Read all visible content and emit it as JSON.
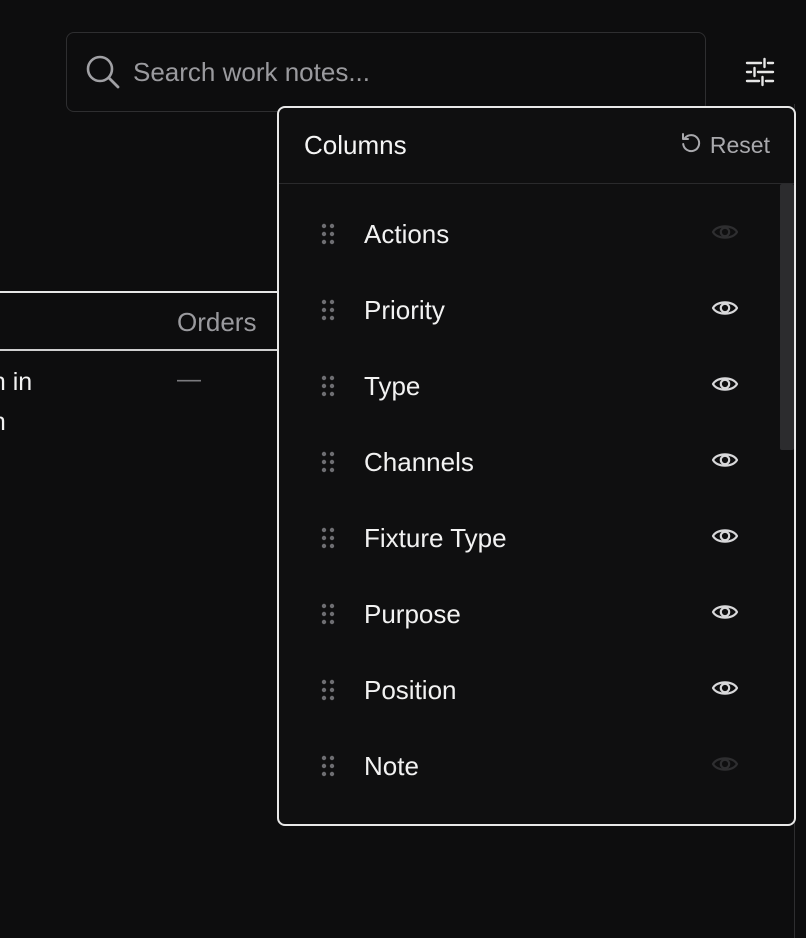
{
  "search": {
    "placeholder": "Search work notes..."
  },
  "toolbar": {
    "filter_icon": "sliders-icon"
  },
  "table": {
    "columns": [
      "Orders"
    ],
    "row_text_lines": [
      "on in",
      "on"
    ],
    "row_orders_value": "—"
  },
  "columns_panel": {
    "title": "Columns",
    "reset_label": "Reset",
    "items": [
      {
        "label": "Actions",
        "visible": false
      },
      {
        "label": "Priority",
        "visible": true
      },
      {
        "label": "Type",
        "visible": true
      },
      {
        "label": "Channels",
        "visible": true
      },
      {
        "label": "Fixture Type",
        "visible": true
      },
      {
        "label": "Purpose",
        "visible": true
      },
      {
        "label": "Position",
        "visible": true
      },
      {
        "label": "Note",
        "visible": false
      }
    ]
  },
  "colors": {
    "background": "#0d0d0e",
    "text": "#f2f2f2",
    "muted": "#9a9a9e",
    "eye_visible": "#d8d8da",
    "eye_hidden": "#2e2e30"
  }
}
